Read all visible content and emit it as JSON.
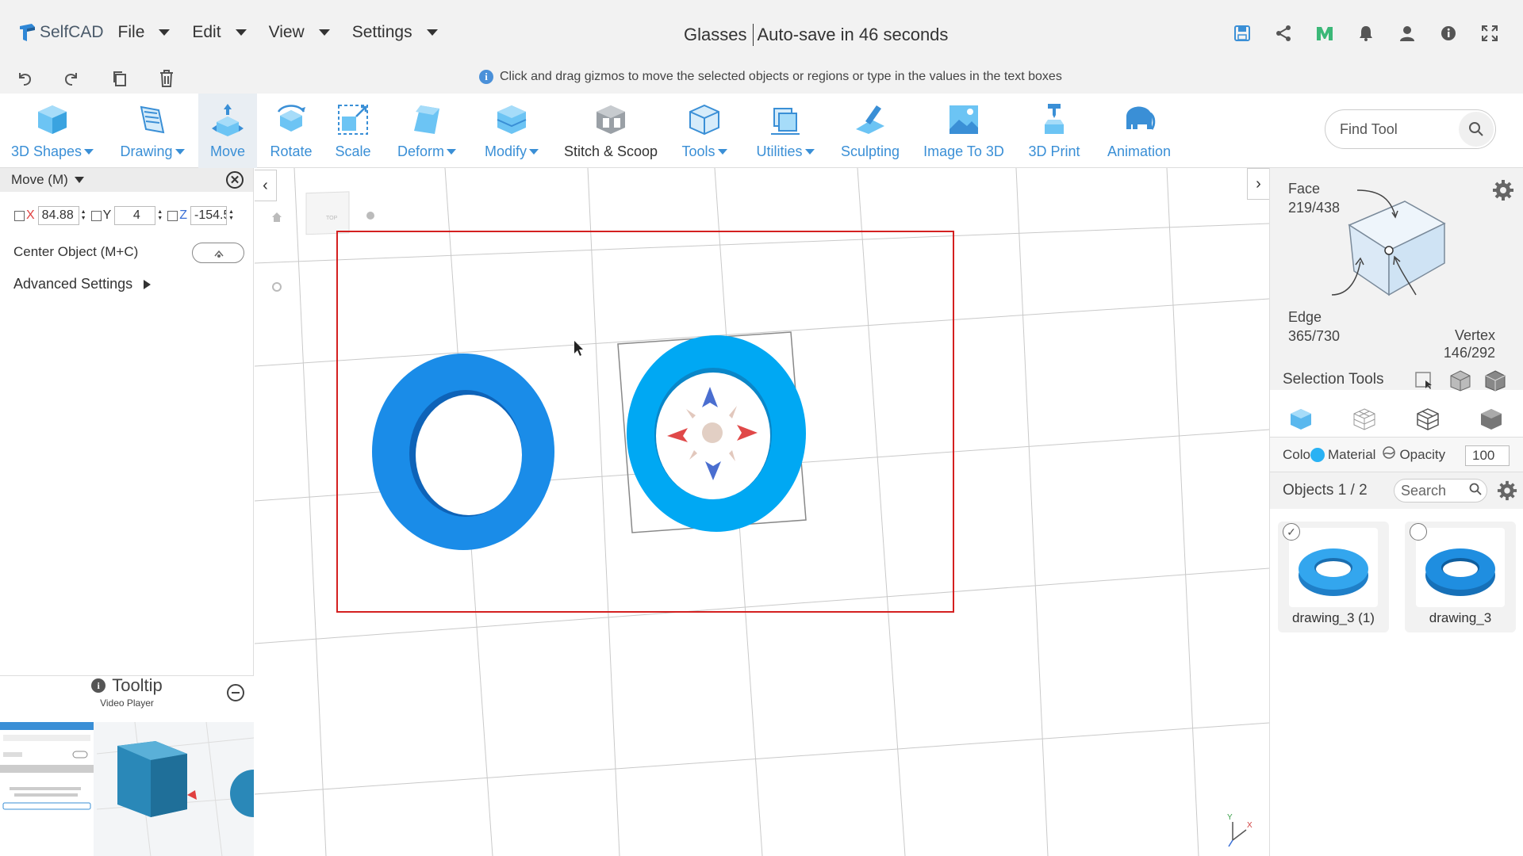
{
  "app": {
    "logo_text": "SelfCAD"
  },
  "menu": [
    {
      "label": "File"
    },
    {
      "label": "Edit"
    },
    {
      "label": "View"
    },
    {
      "label": "Settings"
    }
  ],
  "document": {
    "name": "Glasses",
    "autosave": "Auto-save in 46 seconds"
  },
  "hint": {
    "text": "Click and drag gizmos to move the selected objects or regions or type in the values in the text boxes"
  },
  "tools": {
    "shapes": "3D Shapes",
    "drawing": "Drawing",
    "move": "Move",
    "rotate": "Rotate",
    "scale": "Scale",
    "deform": "Deform",
    "modify": "Modify",
    "stitch": "Stitch & Scoop",
    "tools": "Tools",
    "utilities": "Utilities",
    "sculpting": "Sculpting",
    "image3d": "Image To 3D",
    "print": "3D Print",
    "animation": "Animation"
  },
  "find_tool": {
    "placeholder": "Find Tool"
  },
  "move_panel": {
    "title": "Move (M)",
    "x_label": "X",
    "x_value": "84.88",
    "y_label": "Y",
    "y_value": "4",
    "z_label": "Z",
    "z_value": "-154.5",
    "center_label": "Center Object (M+C)",
    "advanced_label": "Advanced Settings"
  },
  "tooltip": {
    "title": "Tooltip",
    "subtitle": "Video Player"
  },
  "selection": {
    "face_label": "Face",
    "face_count": "219/438",
    "edge_label": "Edge",
    "edge_count": "365/730",
    "vertex_label": "Vertex",
    "vertex_count": "146/292",
    "tools_label": "Selection Tools"
  },
  "material": {
    "color_label": "Colo",
    "material_label": "Material",
    "opacity_label": "Opacity",
    "opacity_value": "100",
    "color": "#29b2f4"
  },
  "objects": {
    "header": "Objects 1 / 2",
    "search_placeholder": "Search",
    "items": [
      {
        "name": "drawing_3 (1)",
        "checked": true
      },
      {
        "name": "drawing_3",
        "checked": false
      }
    ]
  },
  "colors": {
    "accent": "#3a8fd6",
    "selected_ring": "#00a8f3",
    "other_ring": "#1a8ce8",
    "selection_frame": "#d42020"
  }
}
